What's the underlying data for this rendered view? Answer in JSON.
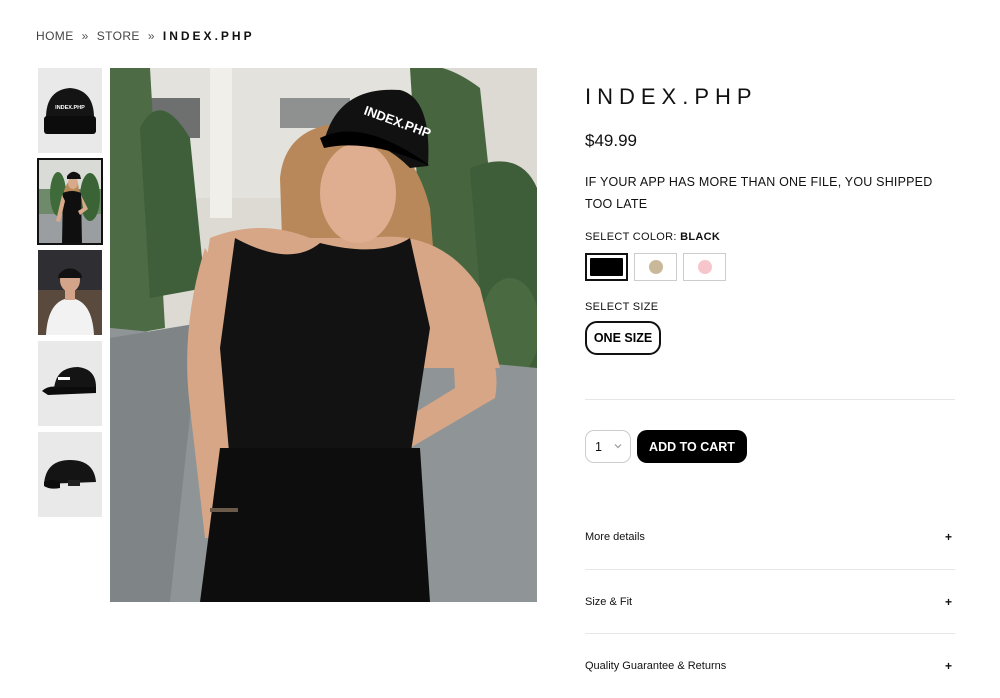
{
  "breadcrumb": {
    "home": "HOME",
    "sep1": "»",
    "store": "STORE",
    "sep2": "»",
    "current": "INDEX.PHP"
  },
  "product": {
    "title": "INDEX.PHP",
    "price": "$49.99",
    "description": "IF YOUR APP HAS MORE THAN ONE FILE, YOU SHIPPED TOO LATE",
    "cap_text": "INDEX.PHP"
  },
  "color": {
    "label": "SELECT COLOR:",
    "selected": "BLACK",
    "swatches": [
      {
        "name": "Black",
        "hex": "#000000"
      },
      {
        "name": "Khaki",
        "hex": "#c9b99a"
      },
      {
        "name": "Pink",
        "hex": "#f7c5cc"
      }
    ]
  },
  "size": {
    "label": "SELECT SIZE",
    "option": "ONE SIZE"
  },
  "cart": {
    "quantity": "1",
    "add_label": "ADD TO CART"
  },
  "accordion": [
    {
      "label": "More details",
      "icon": "+"
    },
    {
      "label": "Size & Fit",
      "icon": "+"
    },
    {
      "label": "Quality Guarantee & Returns",
      "icon": "+"
    }
  ],
  "thumbnails": [
    {
      "name": "cap-front"
    },
    {
      "name": "model-woman",
      "selected": true
    },
    {
      "name": "model-man"
    },
    {
      "name": "cap-side"
    },
    {
      "name": "cap-back"
    }
  ]
}
